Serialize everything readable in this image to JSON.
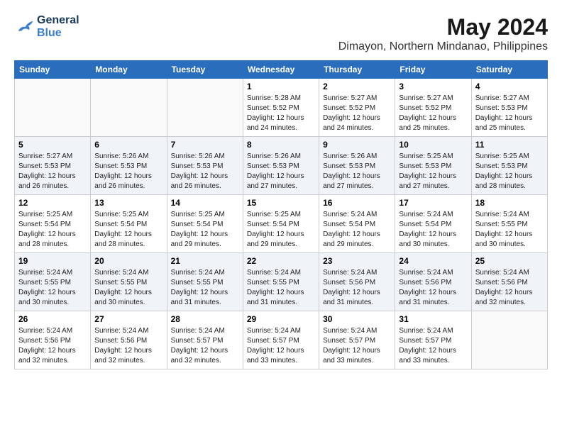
{
  "header": {
    "logo_general": "General",
    "logo_blue": "Blue",
    "month_year": "May 2024",
    "location": "Dimayon, Northern Mindanao, Philippines"
  },
  "days_of_week": [
    "Sunday",
    "Monday",
    "Tuesday",
    "Wednesday",
    "Thursday",
    "Friday",
    "Saturday"
  ],
  "weeks": [
    [
      {
        "day": "",
        "info": ""
      },
      {
        "day": "",
        "info": ""
      },
      {
        "day": "",
        "info": ""
      },
      {
        "day": "1",
        "sunrise": "5:28 AM",
        "sunset": "5:52 PM",
        "daylight": "12 hours and 24 minutes."
      },
      {
        "day": "2",
        "sunrise": "5:27 AM",
        "sunset": "5:52 PM",
        "daylight": "12 hours and 24 minutes."
      },
      {
        "day": "3",
        "sunrise": "5:27 AM",
        "sunset": "5:52 PM",
        "daylight": "12 hours and 25 minutes."
      },
      {
        "day": "4",
        "sunrise": "5:27 AM",
        "sunset": "5:53 PM",
        "daylight": "12 hours and 25 minutes."
      }
    ],
    [
      {
        "day": "5",
        "sunrise": "5:27 AM",
        "sunset": "5:53 PM",
        "daylight": "12 hours and 26 minutes."
      },
      {
        "day": "6",
        "sunrise": "5:26 AM",
        "sunset": "5:53 PM",
        "daylight": "12 hours and 26 minutes."
      },
      {
        "day": "7",
        "sunrise": "5:26 AM",
        "sunset": "5:53 PM",
        "daylight": "12 hours and 26 minutes."
      },
      {
        "day": "8",
        "sunrise": "5:26 AM",
        "sunset": "5:53 PM",
        "daylight": "12 hours and 27 minutes."
      },
      {
        "day": "9",
        "sunrise": "5:26 AM",
        "sunset": "5:53 PM",
        "daylight": "12 hours and 27 minutes."
      },
      {
        "day": "10",
        "sunrise": "5:25 AM",
        "sunset": "5:53 PM",
        "daylight": "12 hours and 27 minutes."
      },
      {
        "day": "11",
        "sunrise": "5:25 AM",
        "sunset": "5:53 PM",
        "daylight": "12 hours and 28 minutes."
      }
    ],
    [
      {
        "day": "12",
        "sunrise": "5:25 AM",
        "sunset": "5:54 PM",
        "daylight": "12 hours and 28 minutes."
      },
      {
        "day": "13",
        "sunrise": "5:25 AM",
        "sunset": "5:54 PM",
        "daylight": "12 hours and 28 minutes."
      },
      {
        "day": "14",
        "sunrise": "5:25 AM",
        "sunset": "5:54 PM",
        "daylight": "12 hours and 29 minutes."
      },
      {
        "day": "15",
        "sunrise": "5:25 AM",
        "sunset": "5:54 PM",
        "daylight": "12 hours and 29 minutes."
      },
      {
        "day": "16",
        "sunrise": "5:24 AM",
        "sunset": "5:54 PM",
        "daylight": "12 hours and 29 minutes."
      },
      {
        "day": "17",
        "sunrise": "5:24 AM",
        "sunset": "5:54 PM",
        "daylight": "12 hours and 30 minutes."
      },
      {
        "day": "18",
        "sunrise": "5:24 AM",
        "sunset": "5:55 PM",
        "daylight": "12 hours and 30 minutes."
      }
    ],
    [
      {
        "day": "19",
        "sunrise": "5:24 AM",
        "sunset": "5:55 PM",
        "daylight": "12 hours and 30 minutes."
      },
      {
        "day": "20",
        "sunrise": "5:24 AM",
        "sunset": "5:55 PM",
        "daylight": "12 hours and 30 minutes."
      },
      {
        "day": "21",
        "sunrise": "5:24 AM",
        "sunset": "5:55 PM",
        "daylight": "12 hours and 31 minutes."
      },
      {
        "day": "22",
        "sunrise": "5:24 AM",
        "sunset": "5:55 PM",
        "daylight": "12 hours and 31 minutes."
      },
      {
        "day": "23",
        "sunrise": "5:24 AM",
        "sunset": "5:56 PM",
        "daylight": "12 hours and 31 minutes."
      },
      {
        "day": "24",
        "sunrise": "5:24 AM",
        "sunset": "5:56 PM",
        "daylight": "12 hours and 31 minutes."
      },
      {
        "day": "25",
        "sunrise": "5:24 AM",
        "sunset": "5:56 PM",
        "daylight": "12 hours and 32 minutes."
      }
    ],
    [
      {
        "day": "26",
        "sunrise": "5:24 AM",
        "sunset": "5:56 PM",
        "daylight": "12 hours and 32 minutes."
      },
      {
        "day": "27",
        "sunrise": "5:24 AM",
        "sunset": "5:56 PM",
        "daylight": "12 hours and 32 minutes."
      },
      {
        "day": "28",
        "sunrise": "5:24 AM",
        "sunset": "5:57 PM",
        "daylight": "12 hours and 32 minutes."
      },
      {
        "day": "29",
        "sunrise": "5:24 AM",
        "sunset": "5:57 PM",
        "daylight": "12 hours and 33 minutes."
      },
      {
        "day": "30",
        "sunrise": "5:24 AM",
        "sunset": "5:57 PM",
        "daylight": "12 hours and 33 minutes."
      },
      {
        "day": "31",
        "sunrise": "5:24 AM",
        "sunset": "5:57 PM",
        "daylight": "12 hours and 33 minutes."
      },
      {
        "day": "",
        "info": ""
      }
    ]
  ],
  "labels": {
    "sunrise": "Sunrise:",
    "sunset": "Sunset:",
    "daylight": "Daylight:"
  }
}
